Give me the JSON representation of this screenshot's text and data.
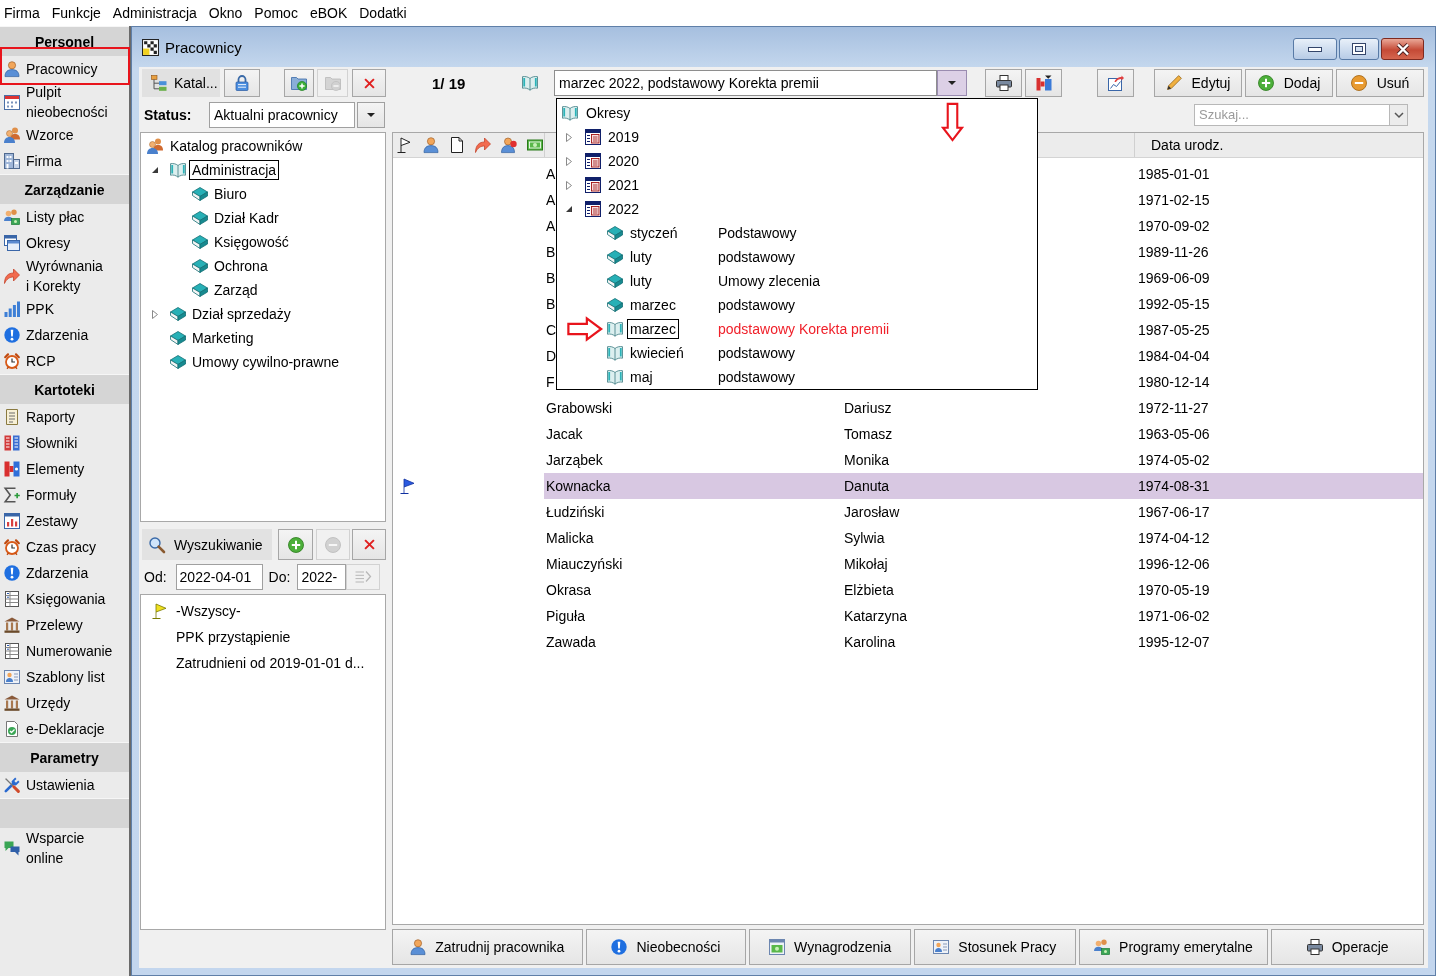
{
  "menu": [
    "Firma",
    "Funkcje",
    "Administracja",
    "Okno",
    "Pomoc",
    "eBOK",
    "Dodatki"
  ],
  "sidebar": {
    "sections": [
      {
        "title": "Personel",
        "items": [
          {
            "label": "Pracownicy",
            "annotated": true
          },
          {
            "label": "Pulpit\nnieobecności",
            "annotated": false
          },
          {
            "label": "Wzorce",
            "annotated": false
          },
          {
            "label": "Firma",
            "annotated": false
          }
        ]
      },
      {
        "title": "Zarządzanie",
        "items": [
          {
            "label": "Listy płac",
            "annotated": false
          },
          {
            "label": "Okresy",
            "annotated": false
          },
          {
            "label": "Wyrównania\ni Korekty",
            "annotated": false
          },
          {
            "label": "PPK",
            "annotated": false
          },
          {
            "label": "Zdarzenia",
            "annotated": false
          },
          {
            "label": "RCP",
            "annotated": false
          }
        ]
      },
      {
        "title": "Kartoteki",
        "items": [
          {
            "label": "Raporty",
            "annotated": false
          },
          {
            "label": "Słowniki",
            "annotated": false
          },
          {
            "label": "Elementy",
            "annotated": false
          },
          {
            "label": "Formuły",
            "annotated": false
          },
          {
            "label": "Zestawy",
            "annotated": false
          },
          {
            "label": "Czas pracy",
            "annotated": false
          },
          {
            "label": "Zdarzenia",
            "annotated": false
          },
          {
            "label": "Księgowania",
            "annotated": false
          },
          {
            "label": "Przelewy",
            "annotated": false
          },
          {
            "label": "Numerowanie",
            "annotated": false
          },
          {
            "label": "Szablony list",
            "annotated": false
          },
          {
            "label": "Urzędy",
            "annotated": false
          },
          {
            "label": "e-Deklaracje",
            "annotated": false
          }
        ]
      },
      {
        "title": "Parametry",
        "items": [
          {
            "label": "Ustawienia",
            "annotated": false
          }
        ]
      },
      {
        "items": [
          {
            "label": "Wsparcie\nonline",
            "annotated": false
          }
        ]
      }
    ]
  },
  "window": {
    "title": "Pracownicy"
  },
  "toolbar": {
    "tools": [
      {
        "kind": "catalog",
        "label": "Katal...",
        "disabled": false
      },
      {
        "kind": "lock",
        "disabled": false
      },
      {
        "kind": "add_folder",
        "disabled": false
      },
      {
        "kind": "remove_folder",
        "disabled": true
      },
      {
        "kind": "delete",
        "disabled": false
      }
    ],
    "counter": "1/ 19",
    "actions": [
      {
        "kind": "edit",
        "label": "Edytuj"
      },
      {
        "kind": "add",
        "label": "Dodaj"
      },
      {
        "kind": "remove",
        "label": "Usuń"
      }
    ]
  },
  "period_picker": {
    "value": "marzec 2022, podstawowy Korekta premii",
    "annotated": true,
    "popup": {
      "label": "Okresy",
      "children": [
        {
          "label": "2019",
          "expanded": false
        },
        {
          "label": "2020",
          "expanded": false
        },
        {
          "label": "2021",
          "expanded": false
        },
        {
          "label": "2022",
          "expanded": true,
          "children": [
            {
              "month": "styczeń",
              "description": "Podstawowy",
              "closed": true,
              "selected": false,
              "annotated": false
            },
            {
              "month": "luty",
              "description": "podstawowy",
              "closed": true,
              "selected": false,
              "annotated": false
            },
            {
              "month": "luty",
              "description": "Umowy zlecenia",
              "closed": true,
              "selected": false,
              "annotated": false
            },
            {
              "month": "marzec",
              "description": "podstawowy",
              "closed": true,
              "selected": false,
              "annotated": false
            },
            {
              "month": "marzec",
              "description": "podstawowy Korekta premii",
              "closed": false,
              "selected": true,
              "annotated": true
            },
            {
              "month": "kwiecień",
              "description": "podstawowy",
              "closed": false,
              "selected": false,
              "annotated": false
            },
            {
              "month": "maj",
              "description": "podstawowy",
              "closed": false,
              "selected": false,
              "annotated": false
            }
          ]
        }
      ]
    }
  },
  "status": {
    "label": "Status:",
    "value": "Aktualni pracownicy"
  },
  "search": {
    "placeholder": "Szukaj..."
  },
  "department_tree": {
    "label": "Katalog pracowników",
    "selected": false,
    "children": [
      {
        "label": "Administracja",
        "selected": true,
        "expanded": true,
        "children": [
          {
            "label": "Biuro",
            "selected": false
          },
          {
            "label": "Dział Kadr",
            "selected": false
          },
          {
            "label": "Księgowość",
            "selected": false
          },
          {
            "label": "Ochrona",
            "selected": false
          },
          {
            "label": "Zarząd",
            "selected": false
          }
        ]
      },
      {
        "label": "Dział sprzedaży",
        "selected": false,
        "expanded": false
      },
      {
        "label": "Marketing",
        "selected": false
      },
      {
        "label": "Umowy cywilno-prawne",
        "selected": false
      }
    ]
  },
  "search_panel": {
    "title": "Wyszukiwanie",
    "buttons": [
      {
        "kind": "add",
        "disabled": false
      },
      {
        "kind": "remove",
        "disabled": true
      },
      {
        "kind": "clear",
        "disabled": false
      }
    ],
    "from_label": "Od:",
    "from_value": "2022-04-01",
    "to_label": "Do:",
    "to_value": "2022-",
    "apply_disabled": true,
    "filters": [
      {
        "label": "-Wszyscy-",
        "selected": true
      },
      {
        "label": "PPK przystąpienie",
        "selected": false
      },
      {
        "label": "Zatrudnieni od 2019-01-01 d...",
        "selected": false
      }
    ]
  },
  "table": {
    "birth_date_header": "Data urodz.",
    "rows": [
      {
        "column_1": "A",
        "birth_date": "1985-01-01",
        "selected": false
      },
      {
        "column_1": "A",
        "birth_date": "1971-02-15",
        "selected": false
      },
      {
        "column_1": "A",
        "birth_date": "1970-09-02",
        "selected": false
      },
      {
        "column_1": "B",
        "birth_date": "1989-11-26",
        "selected": false
      },
      {
        "column_1": "B",
        "birth_date": "1969-06-09",
        "selected": false
      },
      {
        "column_1": "B",
        "birth_date": "1992-05-15",
        "selected": false
      },
      {
        "column_1": "C",
        "birth_date": "1987-05-25",
        "selected": false
      },
      {
        "column_1": "D",
        "birth_date": "1984-04-04",
        "selected": false
      },
      {
        "column_1": "F",
        "birth_date": "1980-12-14",
        "selected": false
      },
      {
        "column_1": "Grabowski",
        "column_2": "Dariusz",
        "birth_date": "1972-11-27",
        "selected": false
      },
      {
        "column_1": "Jacak",
        "column_2": "Tomasz",
        "birth_date": "1963-05-06",
        "selected": false
      },
      {
        "column_1": "Jarząbek",
        "column_2": "Monika",
        "birth_date": "1974-05-02",
        "selected": false
      },
      {
        "column_1": "Kownacka",
        "column_2": "Danuta",
        "birth_date": "1974-08-31",
        "selected": true
      },
      {
        "column_1": "Łudziński",
        "column_2": "Jarosław",
        "birth_date": "1967-06-17",
        "selected": false
      },
      {
        "column_1": "Malicka",
        "column_2": "Sylwia",
        "birth_date": "1974-04-12",
        "selected": false
      },
      {
        "column_1": "Miauczyński",
        "column_2": "Mikołaj",
        "birth_date": "1996-12-06",
        "selected": false
      },
      {
        "column_1": "Okrasa",
        "column_2": "Elżbieta",
        "birth_date": "1970-05-19",
        "selected": false
      },
      {
        "column_1": "Piguła",
        "column_2": "Katarzyna",
        "birth_date": "1971-06-02",
        "selected": false
      },
      {
        "column_1": "Zawada",
        "column_2": "Karolina",
        "birth_date": "1995-12-07",
        "selected": false
      }
    ]
  },
  "bottom_buttons": [
    {
      "kind": "hire",
      "label": "Zatrudnij pracownika"
    },
    {
      "kind": "absences",
      "label": "Nieobecności"
    },
    {
      "kind": "salaries",
      "label": "Wynagrodzenia"
    },
    {
      "kind": "employment",
      "label": "Stosunek Pracy"
    },
    {
      "kind": "pensions",
      "label": "Programy emerytalne"
    },
    {
      "kind": "operations",
      "label": "Operacje"
    }
  ]
}
